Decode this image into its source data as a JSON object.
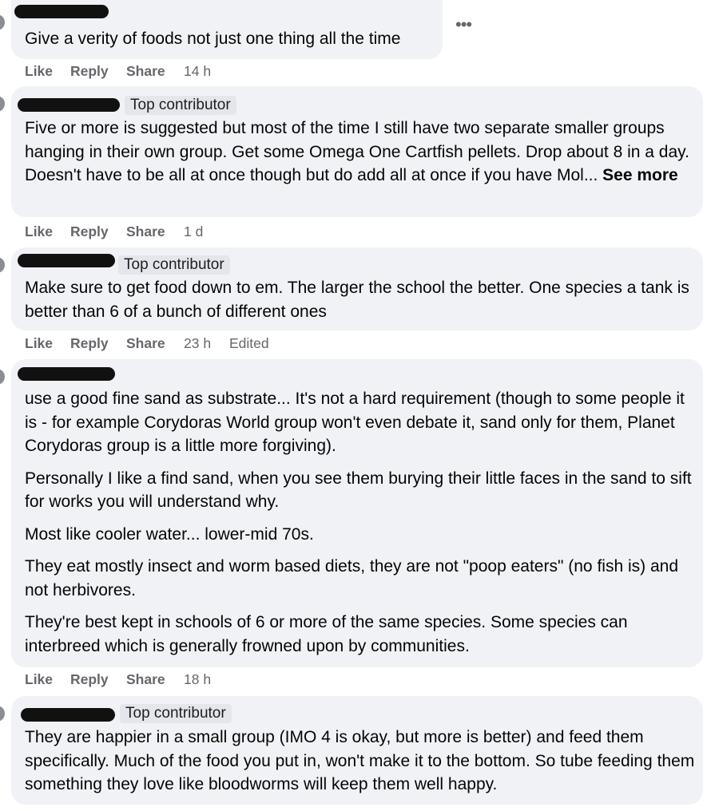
{
  "options_icon_glyph": "•••",
  "actions": {
    "like": "Like",
    "reply": "Reply",
    "share": "Share"
  },
  "comments": [
    {
      "badge": "",
      "paragraphs": [
        "Give a verity of foods not just one thing all the time"
      ],
      "time": "14 h",
      "edited": ""
    },
    {
      "badge": "Top contributor",
      "paragraphs": [
        "Five or more is suggested but most of the time I still have two separate smaller groups hanging in their own group. Get some Omega One Cartfish pellets. Drop about 8 in a day. Doesn't have to be all at once though but do add all at once if you have Mol..."
      ],
      "see_more": "See more",
      "time": "1 d",
      "edited": ""
    },
    {
      "badge": "Top contributor",
      "paragraphs": [
        "Make sure to get food down to em. The larger the school the better. One species a tank is better than 6 of a bunch of different ones"
      ],
      "time": "23 h",
      "edited": "Edited"
    },
    {
      "badge": "",
      "paragraphs": [
        "use a good fine sand as substrate... It's not a hard requirement (though to some people it is - for example Corydoras World group won't even debate it, sand only for them, Planet Corydoras group is a little more forgiving).",
        "Personally I like a find sand, when you see them burying their little faces in the sand to sift for works you will understand why.",
        "Most like cooler water... lower-mid 70s.",
        "They eat mostly insect and worm based diets, they are not \"poop eaters\" (no fish is) and not herbivores.",
        "They're best kept in schools of 6 or more of the same species. Some species can interbreed which is generally frowned upon by communities."
      ],
      "time": "18 h",
      "edited": ""
    },
    {
      "badge": "Top contributor",
      "paragraphs": [
        "They are happier in a small group (IMO 4 is okay, but more is better) and feed them specifically. Much of the food you put in, won't make it to the bottom. So tube feeding them something they love like bloodworms will keep them well happy."
      ],
      "time": "",
      "edited": ""
    }
  ]
}
